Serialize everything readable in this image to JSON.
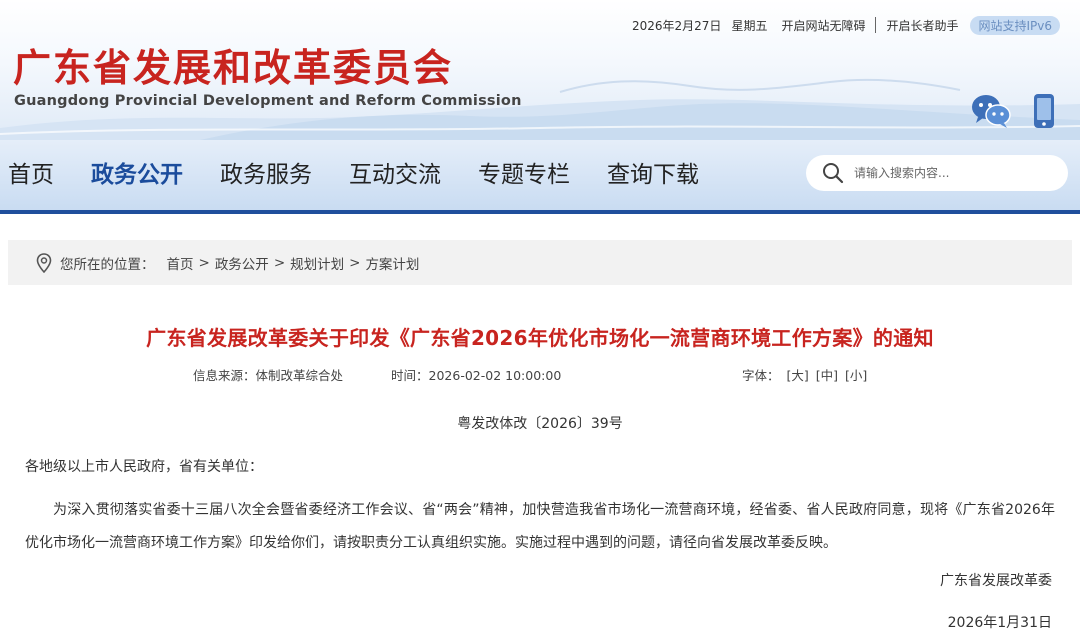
{
  "topbar": {
    "date": "2026年2月27日",
    "weekday": "星期五",
    "accessibility": "开启网站无障碍",
    "elderly": "开启长者助手",
    "ipv6": "网站支持IPv6"
  },
  "logo": {
    "cn": "广东省发展和改革委员会",
    "en": "Guangdong Provincial Development and Reform Commission"
  },
  "header_icons": [
    "wechat-icon",
    "mobile-icon"
  ],
  "nav": {
    "items": [
      {
        "label": "首页"
      },
      {
        "label": "政务公开"
      },
      {
        "label": "政务服务"
      },
      {
        "label": "互动交流"
      },
      {
        "label": "专题专栏"
      },
      {
        "label": "查询下载"
      }
    ],
    "active_index": 1
  },
  "search": {
    "placeholder": "请输入搜索内容..."
  },
  "breadcrumb": {
    "label": "您所在的位置：",
    "items": [
      "首页",
      "政务公开",
      "规划计划",
      "方案计划"
    ],
    "separator": ">"
  },
  "article": {
    "title": "广东省发展改革委关于印发《广东省2026年优化市场化一流营商环境工作方案》的通知",
    "source_label": "信息来源：",
    "source": "体制改革综合处",
    "time_label": "时间：",
    "time": "2026-02-02 10:00:00",
    "font_label": "字体：",
    "font_sizes": [
      "[大]",
      "[中]",
      "[小]"
    ],
    "doc_no": "粤发改体改〔2026〕39号",
    "addressee": "各地级以上市人民政府，省有关单位：",
    "body": "为深入贯彻落实省委十三届八次全会暨省委经济工作会议、省“两会”精神，加快营造我省市场化一流营商环境，经省委、省人民政府同意，现将《广东省2026年优化市场化一流营商环境工作方案》印发给你们，请按职责分工认真组织实施。实施过程中遇到的问题，请径向省发展改革委反映。",
    "signature": "广东省发展改革委",
    "date": "2026年1月31日"
  },
  "colors": {
    "brand_red": "#c8241f",
    "nav_active": "#1b4c9c",
    "nav_border": "#1f4f9c",
    "ipv6_bg": "#c8dcf3"
  }
}
